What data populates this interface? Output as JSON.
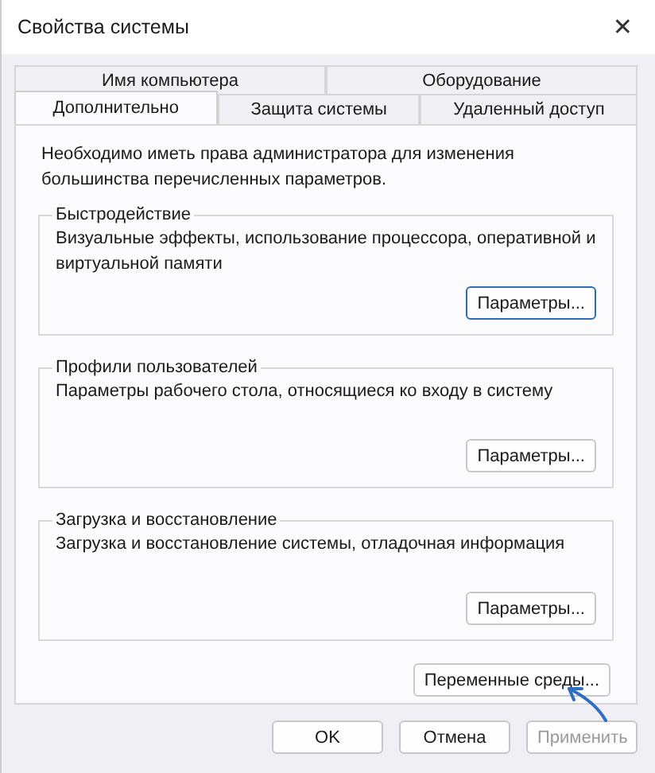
{
  "window": {
    "title": "Свойства системы",
    "close_glyph": "✕"
  },
  "tab_rows": [
    [
      {
        "label": "Имя компьютера",
        "selected": false
      },
      {
        "label": "Оборудование",
        "selected": false
      }
    ],
    [
      {
        "label": "Дополнительно",
        "selected": true
      },
      {
        "label": "Защита системы",
        "selected": false
      },
      {
        "label": "Удаленный доступ",
        "selected": false
      }
    ]
  ],
  "notice": "Необходимо иметь права администратора для изменения большинства перечисленных параметров.",
  "groups": [
    {
      "title": "Быстродействие",
      "description": "Визуальные эффекты, использование процессора, оперативной и виртуальной памяти",
      "button": {
        "label": "Параметры...",
        "focused": true
      }
    },
    {
      "title": "Профили пользователей",
      "description": "Параметры рабочего стола, относящиеся ко входу в систему",
      "button": {
        "label": "Параметры...",
        "focused": false
      }
    },
    {
      "title": "Загрузка и восстановление",
      "description": "Загрузка и восстановление системы, отладочная информация",
      "button": {
        "label": "Параметры...",
        "focused": false
      }
    }
  ],
  "env_button": {
    "label": "Переменные среды..."
  },
  "buttons": [
    {
      "label": "OK",
      "disabled": false
    },
    {
      "label": "Отмена",
      "disabled": false
    },
    {
      "label": "Применить",
      "disabled": true
    }
  ]
}
